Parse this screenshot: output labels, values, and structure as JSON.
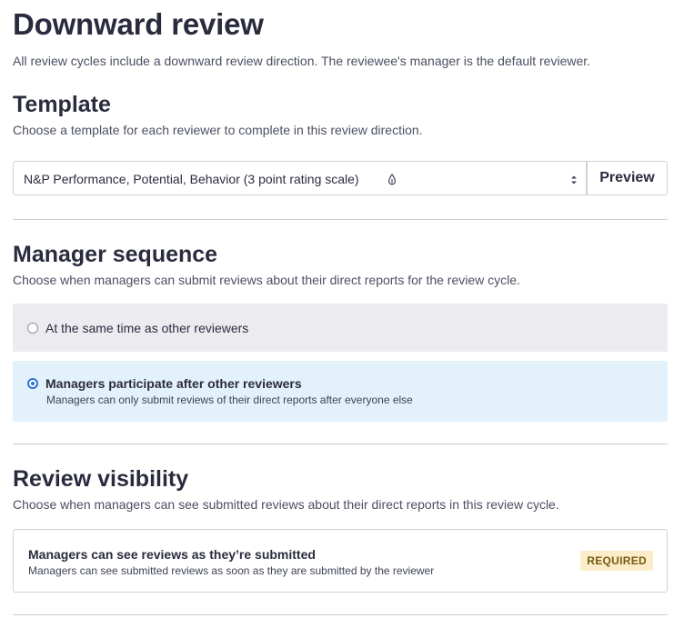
{
  "header": {
    "title": "Downward review",
    "subtitle": "All review cycles include a downward review direction. The reviewee's manager is the default reviewer."
  },
  "template_section": {
    "title": "Template",
    "description": "Choose a template for each reviewer to complete in this review direction.",
    "select": {
      "selected_value": "N&P Performance, Potential, Behavior (3 point rating scale)",
      "trailing_icon": "drop-icon",
      "arrows_icon": "select-arrows-icon"
    },
    "preview_label": "Preview"
  },
  "manager_sequence": {
    "title": "Manager sequence",
    "description": "Choose when managers can submit reviews about their direct reports for the review cycle.",
    "options": [
      {
        "label": "At the same time as other reviewers",
        "selected": false
      },
      {
        "label": "Managers participate after other reviewers",
        "hint": "Managers can only submit reviews of their direct reports after everyone else",
        "selected": true
      }
    ]
  },
  "review_visibility": {
    "title": "Review visibility",
    "description": "Choose when managers can see submitted reviews about their direct reports in this review cycle.",
    "card": {
      "title": "Managers can see reviews as they’re submitted",
      "description": "Managers can see submitted reviews as soon as they are submitted by the reviewer",
      "badge": "REQUIRED"
    }
  },
  "colors": {
    "text_primary": "#2a2c3e",
    "selected_option_bg": "#e3f1fb",
    "unselected_option_bg": "#ececf0",
    "radio_accent": "#2f6fd6",
    "badge_bg": "#fbedc9",
    "badge_text": "#7a5a12"
  }
}
